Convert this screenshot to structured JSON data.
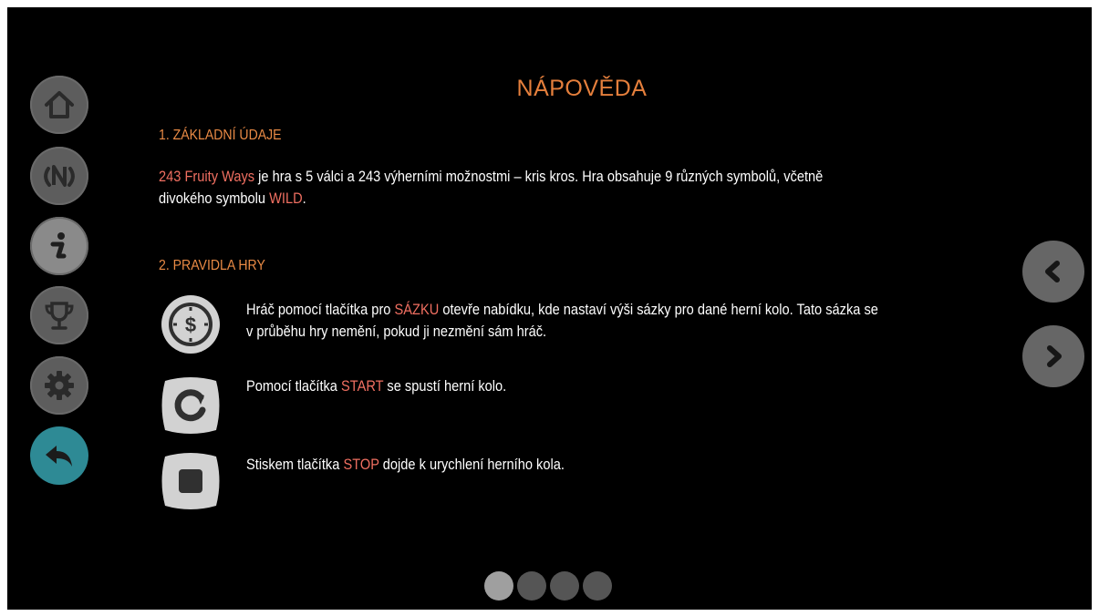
{
  "title": "NÁPOVĚDA",
  "sections": {
    "basic": {
      "heading": "1. ZÁKLADNÍ ÚDAJE",
      "game_name": "243 Fruity Ways",
      "text_1": " je hra s 5 válci a 243 výherními možnostmi – kris kros. Hra obsahuje 9 různých symbolů, včetně",
      "text_2": "divokého symbolu ",
      "wild": "WILD",
      "text_3": "."
    },
    "rules": {
      "heading": "2. PRAVIDLA HRY",
      "bet": {
        "icon": "coin-dollar-icon",
        "text_1": "Hráč pomocí tlačítka pro ",
        "keyword": "SÁZKU",
        "text_2": " otevře nabídku, kde nastaví výši sázky pro dané herní kolo. Tato sázka se",
        "text_3": "v průběhu hry nemění, pokud ji nezmění sám hráč."
      },
      "start": {
        "icon": "spin-arrow-icon",
        "text_1": "Pomocí tlačítka ",
        "keyword": "START",
        "text_2": " se spustí herní kolo."
      },
      "stop": {
        "icon": "stop-square-icon",
        "text_1": "Stiskem tlačítka ",
        "keyword": "STOP",
        "text_2": " dojde k urychlení herního kola."
      }
    }
  },
  "menu": [
    {
      "id": "home",
      "icon": "home-icon"
    },
    {
      "id": "logo",
      "icon": "game-logo-icon"
    },
    {
      "id": "info",
      "icon": "info-icon"
    },
    {
      "id": "trophy",
      "icon": "trophy-icon"
    },
    {
      "id": "settings",
      "icon": "gear-icon"
    },
    {
      "id": "back",
      "icon": "back-arrow-icon",
      "active": true
    }
  ],
  "pagination": {
    "pages": 4,
    "current": 1
  },
  "colors": {
    "accent_orange": "#e57f3c",
    "highlight_red": "#f06f61",
    "active_teal": "#2e8a95",
    "button_gray": "#5d5d5d"
  }
}
